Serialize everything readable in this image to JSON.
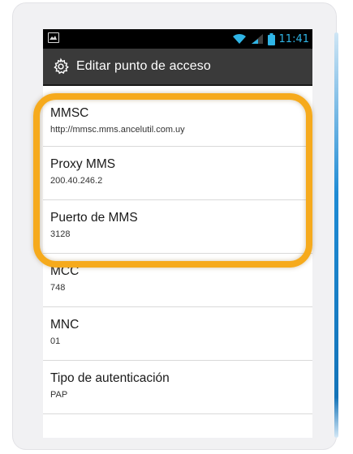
{
  "status_bar": {
    "time": "11:41",
    "icons": [
      "image-notification-icon",
      "wifi-icon",
      "signal-icon",
      "battery-icon"
    ]
  },
  "action_bar": {
    "title": "Editar punto de acceso",
    "icon": "gear-icon"
  },
  "settings": [
    {
      "title": "MMSC",
      "value": "http://mmsc.mms.ancelutil.com.uy"
    },
    {
      "title": "Proxy MMS",
      "value": "200.40.246.2"
    },
    {
      "title": "Puerto de MMS",
      "value": "3128"
    },
    {
      "title": "MCC",
      "value": "748"
    },
    {
      "title": "MNC",
      "value": "01"
    },
    {
      "title": "Tipo de autenticación",
      "value": "PAP"
    }
  ],
  "colors": {
    "highlight": "#f6aa1c",
    "status_accent": "#2fb5e6",
    "action_bar": "#3a3a3a"
  }
}
